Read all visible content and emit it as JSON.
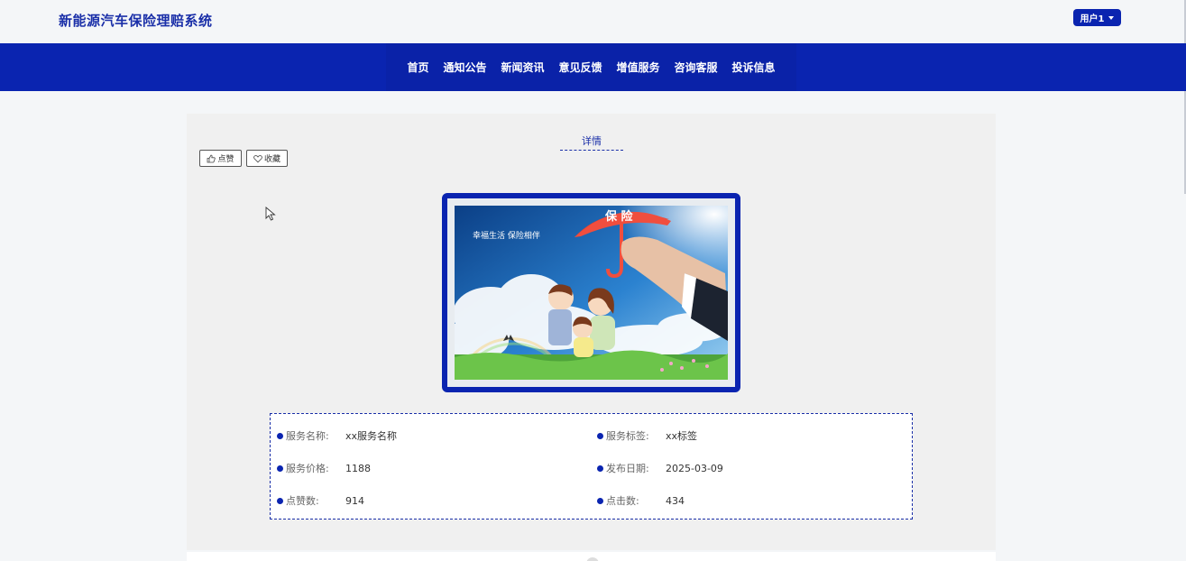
{
  "app": {
    "title": "新能源汽车保险理赔系统",
    "user_label": "用户1"
  },
  "nav": {
    "items": [
      {
        "label": "首页"
      },
      {
        "label": "通知公告"
      },
      {
        "label": "新闻资讯"
      },
      {
        "label": "意见反馈"
      },
      {
        "label": "增值服务"
      },
      {
        "label": "咨询客服"
      },
      {
        "label": "投诉信息"
      }
    ]
  },
  "detail": {
    "title": "详情",
    "like_label": "点赞",
    "favorite_label": "收藏",
    "banner": {
      "umbrella_text": "保 险",
      "slogan": "幸福生活 保险相伴"
    },
    "fields": [
      {
        "label": "服务名称:",
        "value": "xx服务名称"
      },
      {
        "label": "服务标签:",
        "value": "xx标签"
      },
      {
        "label": "服务价格:",
        "value": "1188"
      },
      {
        "label": "发布日期:",
        "value": "2025-03-09"
      },
      {
        "label": "点赞数:",
        "value": "914"
      },
      {
        "label": "点击数:",
        "value": "434"
      }
    ]
  },
  "colors": {
    "brand": "#0a24b0",
    "title_text": "#1a2fa8",
    "panel_bg": "#f0f0f0",
    "umbrella": "#f04e3e"
  }
}
